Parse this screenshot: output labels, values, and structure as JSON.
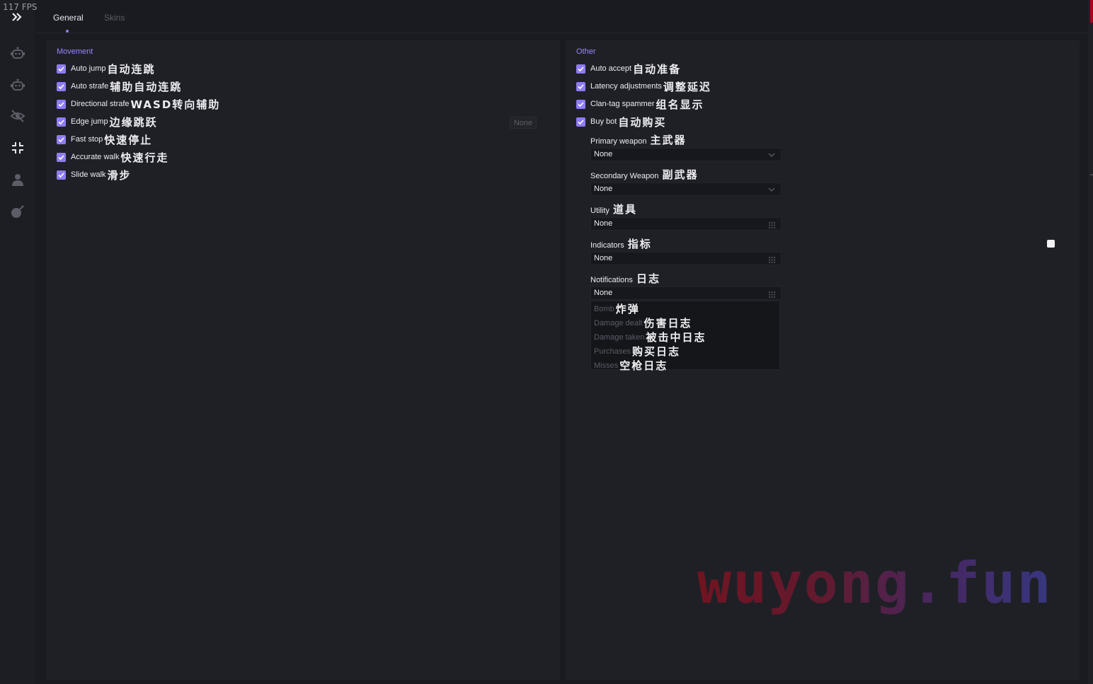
{
  "fps": "117 FPS",
  "tabs": [
    {
      "label": "General",
      "active": true
    },
    {
      "label": "Skins",
      "active": false
    }
  ],
  "sidebar": {
    "icons": [
      "expand-icon",
      "bot-icon",
      "bot-icon",
      "eye-off-icon",
      "compress-icon",
      "user-icon",
      "bomb-icon"
    ]
  },
  "movement": {
    "title": "Movement",
    "items": [
      {
        "label": "Auto jump",
        "cn": "自动连跳"
      },
      {
        "label": "Auto strafe",
        "cn": "辅助自动连跳"
      },
      {
        "label": "Directional strafe",
        "cn": "WASD转向辅助"
      },
      {
        "label": "Edge jump",
        "cn": "边缘跳跃"
      },
      {
        "label": "Fast stop",
        "cn": "快速停止"
      },
      {
        "label": "Accurate walk",
        "cn": "快速行走"
      },
      {
        "label": "Slide walk",
        "cn": "滑步"
      }
    ],
    "edge_jump_key": "None"
  },
  "other": {
    "title": "Other",
    "items": [
      {
        "label": "Auto accept",
        "cn": "自动准备"
      },
      {
        "label": "Latency adjustments",
        "cn": "调整延迟"
      },
      {
        "label": "Clan-tag spammer",
        "cn": "组名显示"
      },
      {
        "label": "Buy bot",
        "cn": "自动购买"
      }
    ],
    "primary": {
      "label": "Primary weapon",
      "cn": "主武器",
      "value": "None"
    },
    "secondary": {
      "label": "Secondary Weapon",
      "cn": "副武器",
      "value": "None"
    },
    "utility": {
      "label": "Utility",
      "cn": "道具",
      "value": "None"
    },
    "indicators": {
      "label": "Indicators",
      "cn": "指标",
      "value": "None"
    },
    "notifications": {
      "label": "Notifications",
      "cn": "日志",
      "value": "None",
      "options": [
        {
          "label": "Bomb",
          "cn": "炸弹"
        },
        {
          "label": "Damage dealt",
          "cn": "伤害日志"
        },
        {
          "label": "Damage taken",
          "cn": "被击中日志"
        },
        {
          "label": "Purchases",
          "cn": "购买日志"
        },
        {
          "label": "Misses",
          "cn": "空枪日志"
        }
      ]
    }
  },
  "watermark": "wuyong.fun",
  "colors": {
    "accent": "#8f7cf4",
    "title": "#9b86ff",
    "background": "#1a1b20",
    "panel": "#1f2026"
  }
}
